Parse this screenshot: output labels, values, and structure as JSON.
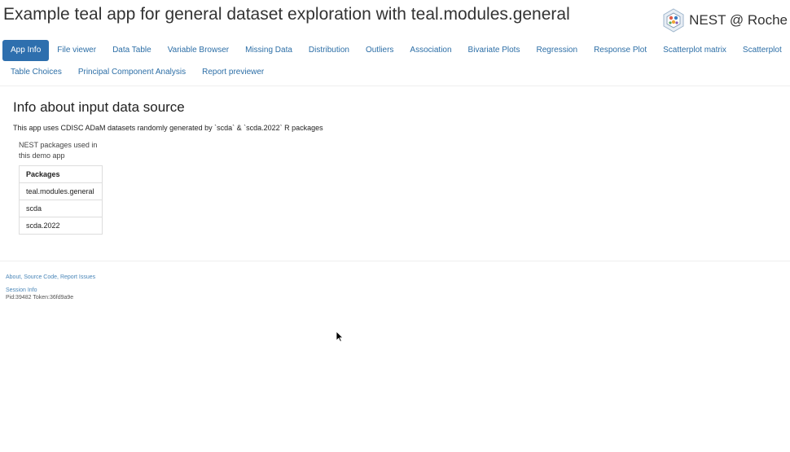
{
  "header": {
    "title": "Example teal app for general dataset exploration with teal.modules.general",
    "brand_text": "NEST @ Roche",
    "brand_icon": "nest-logo-icon"
  },
  "tabs": {
    "row1": [
      {
        "label": "App Info",
        "active": true
      },
      {
        "label": "File viewer"
      },
      {
        "label": "Data Table"
      },
      {
        "label": "Variable Browser"
      },
      {
        "label": "Missing Data"
      },
      {
        "label": "Distribution"
      },
      {
        "label": "Outliers"
      },
      {
        "label": "Association"
      },
      {
        "label": "Bivariate Plots"
      },
      {
        "label": "Regression"
      },
      {
        "label": "Response Plot"
      },
      {
        "label": "Scatterplot matrix"
      },
      {
        "label": "Scatterplot"
      }
    ],
    "row2": [
      {
        "label": "Table Choices"
      },
      {
        "label": "Principal Component Analysis"
      },
      {
        "label": "Report previewer"
      }
    ]
  },
  "main": {
    "heading": "Info about input data source",
    "intro": "This app uses CDISC ADaM datasets randomly generated by `scda` & `scda.2022` R packages",
    "packages_caption": "NEST packages used in this demo app",
    "packages_header": "Packages",
    "packages": [
      "teal.modules.general",
      "scda",
      "scda.2022"
    ]
  },
  "footer": {
    "about": "About",
    "source_code": "Source Code",
    "report_issues": "Report Issues",
    "sep": ", ",
    "session_info": "Session Info",
    "pid_token": "Pid:39482 Token:36fd9a9e"
  },
  "colors": {
    "accent": "#2e6fae",
    "link": "#2c6ea6"
  }
}
